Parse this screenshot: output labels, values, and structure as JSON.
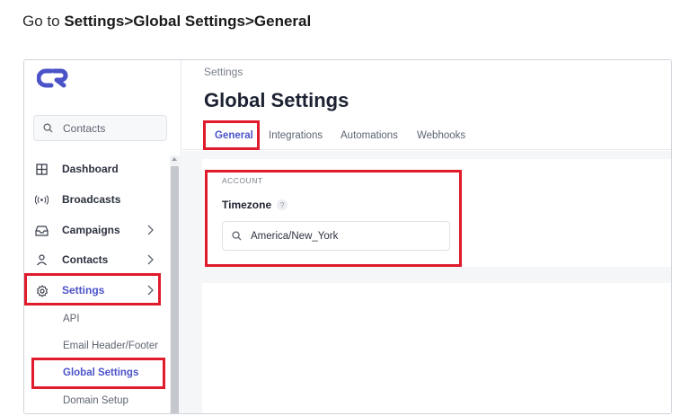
{
  "instruction": {
    "prefix": "Go to ",
    "path": "Settings>Global Settings>General"
  },
  "sidebar": {
    "logo_icon": "cr-logo-icon",
    "search": {
      "placeholder": "Contacts",
      "icon": "search-icon"
    },
    "items": [
      {
        "label": "Dashboard",
        "icon": "grid-icon",
        "has_submenu": false
      },
      {
        "label": "Broadcasts",
        "icon": "broadcast-icon",
        "has_submenu": false
      },
      {
        "label": "Campaigns",
        "icon": "inbox-icon",
        "has_submenu": true
      },
      {
        "label": "Contacts",
        "icon": "user-icon",
        "has_submenu": true
      },
      {
        "label": "Settings",
        "icon": "gear-icon",
        "has_submenu": true,
        "active": true
      }
    ],
    "settings_subitems": [
      {
        "label": "API"
      },
      {
        "label": "Email Header/Footer"
      },
      {
        "label": "Global Settings",
        "active": true
      },
      {
        "label": "Domain Setup"
      }
    ]
  },
  "main": {
    "breadcrumb": "Settings",
    "title": "Global Settings",
    "tabs": [
      {
        "label": "General",
        "active": true
      },
      {
        "label": "Integrations"
      },
      {
        "label": "Automations"
      },
      {
        "label": "Webhooks"
      }
    ],
    "account": {
      "section_label": "ACCOUNT",
      "timezone_label": "Timezone",
      "help_glyph": "?",
      "timezone_value": "America/New_York"
    }
  },
  "colors": {
    "accent": "#4b53c8",
    "highlight": "#e01b2b"
  }
}
